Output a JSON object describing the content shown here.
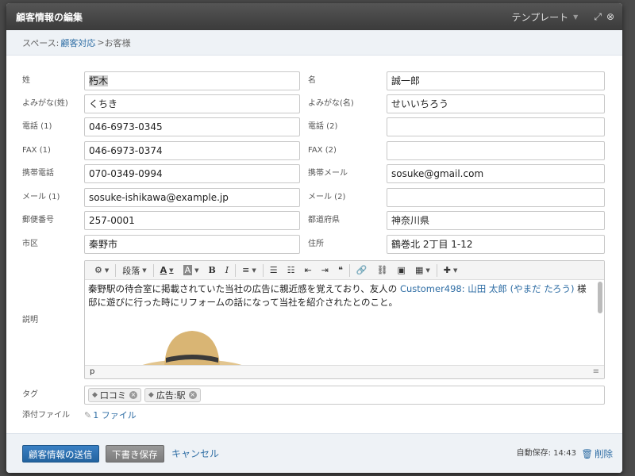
{
  "dialog": {
    "title": "顧客情報の編集",
    "template_label": "テンプレート",
    "caret": "▼",
    "expand_icon": "⤢",
    "close_icon": "⊗"
  },
  "breadcrumb": {
    "prefix": "スペース:",
    "space": "顧客対応",
    "separator": ">",
    "current": "お客様"
  },
  "fields": {
    "last_name": {
      "label": "姓",
      "value": "朽木"
    },
    "first_name": {
      "label": "名",
      "value": "誠一郎"
    },
    "last_kana": {
      "label": "よみがな(姓)",
      "value": "くちき"
    },
    "first_kana": {
      "label": "よみがな(名)",
      "value": "せいいちろう"
    },
    "phone1": {
      "label": "電話 (1)",
      "value": "046-6973-0345"
    },
    "phone2": {
      "label": "電話 (2)",
      "value": ""
    },
    "fax1": {
      "label": "FAX (1)",
      "value": "046-6973-0374"
    },
    "fax2": {
      "label": "FAX (2)",
      "value": ""
    },
    "mobile_phone": {
      "label": "携帯電話",
      "value": "070-0349-0994"
    },
    "mobile_mail": {
      "label": "携帯メール",
      "value": "sosuke@gmail.com"
    },
    "mail1": {
      "label": "メール (1)",
      "value": "sosuke-ishikawa@example.jp"
    },
    "mail2": {
      "label": "メール (2)",
      "value": ""
    },
    "zip": {
      "label": "郵便番号",
      "value": "257-0001"
    },
    "prefecture": {
      "label": "都道府県",
      "value": "神奈川県"
    },
    "city": {
      "label": "市区",
      "value": "秦野市"
    },
    "address": {
      "label": "住所",
      "value": "鶴巻北 2丁目 1-12"
    },
    "description": {
      "label": "説明"
    },
    "tags": {
      "label": "タグ"
    },
    "attachments": {
      "label": "添付ファイル",
      "value": "1 ファイル"
    }
  },
  "editor": {
    "toolbar": {
      "gear": "⚙",
      "paragraph": "段落",
      "font_color": "A",
      "bg_color": "A",
      "bold": "B",
      "italic": "I",
      "align": "≡",
      "bullets": "☰",
      "numbers": "☷",
      "outdent": "⇤",
      "indent": "⇥",
      "quote": "❝",
      "link": "🔗",
      "unlink": "⛓",
      "image": "▣",
      "table": "▦",
      "plugin": "✚",
      "caret": "▼"
    },
    "text_before": "秦野駅の待合室に掲載されていた当社の広告に親近感を覚えており、友人の ",
    "mention": "Customer498: 山田 太郎 (やまだ たろう)",
    "text_after": " 様邸に遊びに行った時にリフォームの話になって当社を紹介されたとのこと。",
    "status_path": "p",
    "grip": "≡"
  },
  "tags": [
    {
      "label": "口コミ",
      "remove": "×"
    },
    {
      "label": "広告:駅",
      "remove": "×"
    }
  ],
  "tag_icon": "◆",
  "clip_icon": "✎",
  "footer": {
    "submit": "顧客情報の送信",
    "draft": "下書き保存",
    "cancel": "キャンセル",
    "autosave": "自動保存: 14:43",
    "trash_icon": "🗑",
    "delete": "削除"
  },
  "colors": {
    "accent": "#2e6da4",
    "titlebar": "#3b3b3b",
    "footer_bg": "#eef2f6"
  }
}
